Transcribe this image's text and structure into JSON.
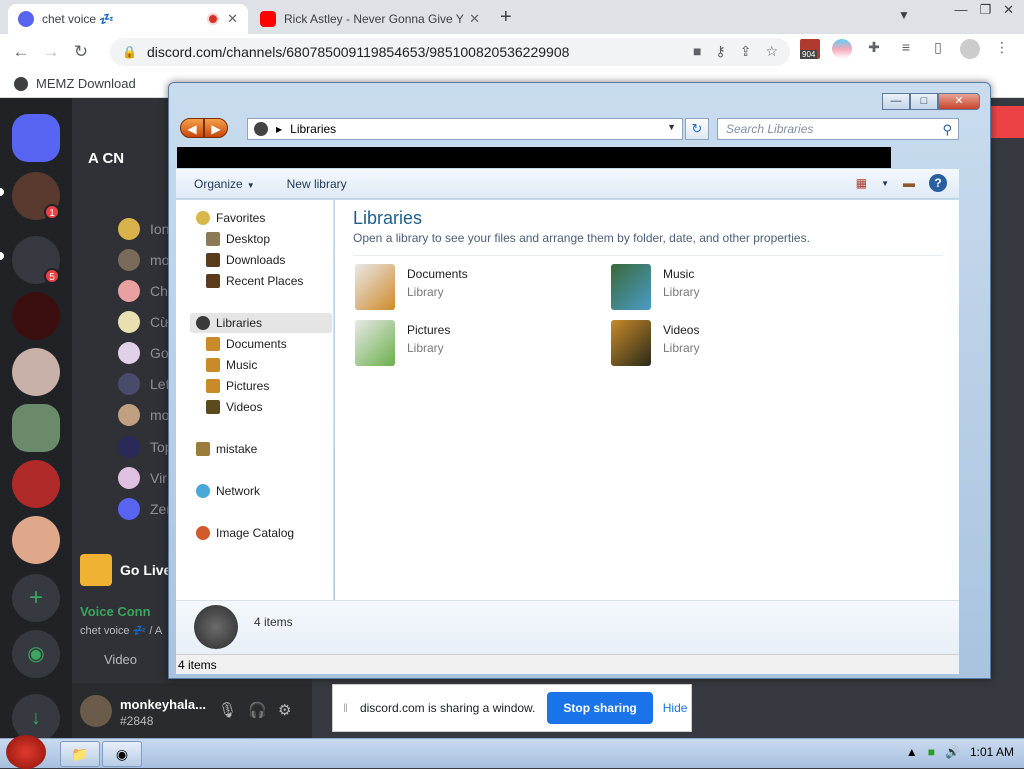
{
  "browser": {
    "tabs": [
      {
        "title": "chet voice 💤",
        "active": true,
        "close": "✕"
      },
      {
        "title": "Rick Astley - Never Gonna Give Y",
        "active": false,
        "close": "✕"
      }
    ],
    "new_tab": "+",
    "window_controls": [
      "—",
      "❐",
      "✕"
    ],
    "url": "discord.com/channels/680785009119854653/985100820536229908",
    "extension_badge": "904",
    "bookmarks": [
      "MEMZ Download"
    ]
  },
  "discord": {
    "server_badges": [
      "1",
      "5"
    ],
    "server_name": "A CN",
    "members": [
      "Ion",
      "mo",
      "Chi",
      "Cừ",
      "Go",
      "Let",
      "mo",
      "Top",
      "Vir",
      "Zer"
    ],
    "go_live": "Go Live",
    "voice_status": "Voice Conn",
    "voice_sub": "chet voice 💤 / A",
    "video_label": "Video",
    "user": {
      "name": "monkeyhala...",
      "tag": "#2848"
    }
  },
  "explorer": {
    "caption_buttons": {
      "minimize": "—",
      "maximize": "□",
      "close": "✕"
    },
    "address": "Libraries",
    "search_placeholder": "Search Libraries",
    "commands": {
      "organize": "Organize",
      "new_library": "New library"
    },
    "nav": [
      {
        "label": "Favorites",
        "level": 0,
        "color": "#d9b84a"
      },
      {
        "label": "Desktop",
        "level": 1,
        "color": "#8c7a54"
      },
      {
        "label": "Downloads",
        "level": 1,
        "color": "#5a3b1c"
      },
      {
        "label": "Recent Places",
        "level": 1,
        "color": "#5a3b1c"
      },
      {
        "label": "Libraries",
        "level": 0,
        "color": "#3a3a3a",
        "selected": true
      },
      {
        "label": "Documents",
        "level": 1,
        "color": "#c98a2a"
      },
      {
        "label": "Music",
        "level": 1,
        "color": "#c98a2a"
      },
      {
        "label": "Pictures",
        "level": 1,
        "color": "#c98a2a"
      },
      {
        "label": "Videos",
        "level": 1,
        "color": "#5a4a1c"
      },
      {
        "label": "mistake",
        "level": 0,
        "color": "#9a7b3a"
      },
      {
        "label": "Network",
        "level": 0,
        "color": "#4aa8d8"
      },
      {
        "label": "Image Catalog",
        "level": 0,
        "color": "#d05a2a"
      }
    ],
    "heading": "Libraries",
    "subheading": "Open a library to see your files and arrange them by folder, date, and other properties.",
    "libraries": [
      {
        "name": "Documents",
        "type": "Library",
        "color": "#d08a2a"
      },
      {
        "name": "Music",
        "type": "Library",
        "color": "#4a9cc8"
      },
      {
        "name": "Pictures",
        "type": "Library",
        "color": "#6ab04a"
      },
      {
        "name": "Videos",
        "type": "Library",
        "color": "#3a3a2a"
      }
    ],
    "item_count_detail": "4 items",
    "status": "4 items"
  },
  "share_bar": {
    "message": "discord.com is sharing a window.",
    "stop": "Stop sharing",
    "hide": "Hide"
  },
  "taskbar": {
    "time": "1:01 AM"
  }
}
